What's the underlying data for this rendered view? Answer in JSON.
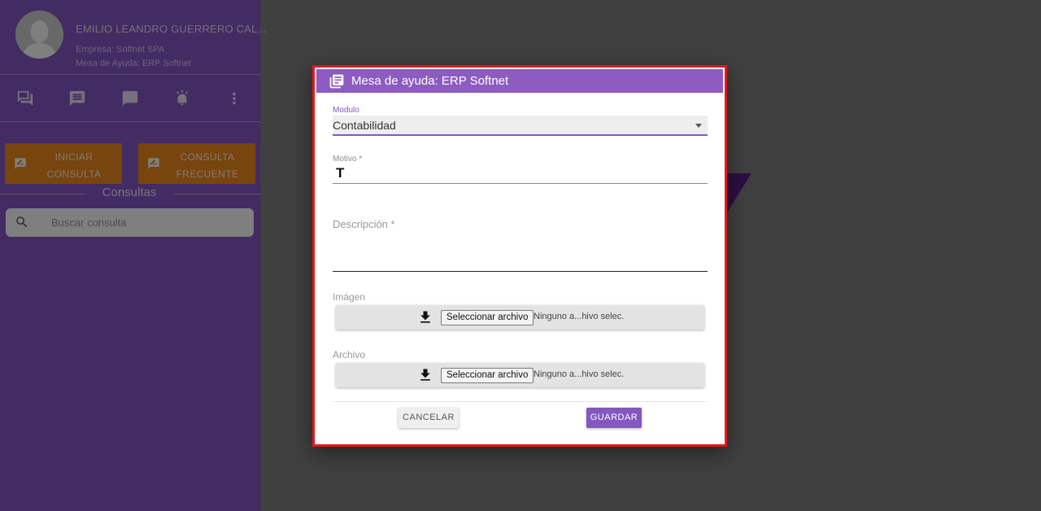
{
  "user": {
    "name": "EMILIO LEANDRO GUERRERO CAL...",
    "company_line": "Empresa: Softnet SPA",
    "desk_line": "Mesa de Ayuda: ERP Softnet"
  },
  "toolbar_icons": [
    "chat-list-icon",
    "message-icon",
    "chat-bubble-icon",
    "alarm-icon",
    "more-vert-icon"
  ],
  "actions": {
    "start": "INICIAR CONSULTA",
    "frequent": "CONSULTA FRECUENTE"
  },
  "consultas": {
    "title": "Consultas",
    "search_placeholder": "Buscar consulta"
  },
  "dialog": {
    "title": "Mesa de ayuda: ERP Softnet",
    "modulo_label": "Modulo",
    "modulo_value": "Contabilidad",
    "motivo_label": "Motivo *",
    "motivo_value": "T",
    "descripcion_label": "Descripción *",
    "imagen_label": "Imágen",
    "archivo_label": "Archivo",
    "file_button": "Seleccionar archivo",
    "file_status": "Ninguno a...hivo selec.",
    "cancel": "CANCELAR",
    "save": "GUARDAR"
  },
  "colors": {
    "sidebar": "#8756c6",
    "accent": "#8557c0",
    "orange": "#f08a1e",
    "dialog_border": "#e0191c"
  }
}
